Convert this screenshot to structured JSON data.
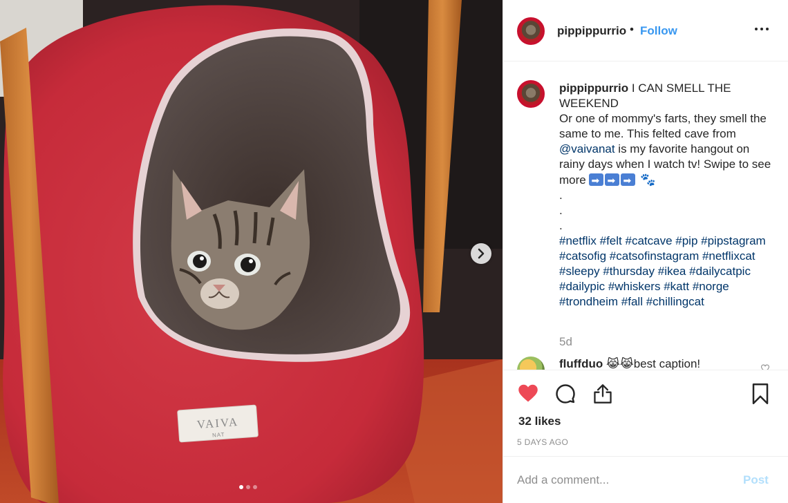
{
  "post": {
    "image_slides": 3,
    "active_slide": 1,
    "badge_text": "VAIVA",
    "badge_subtext": "NAT"
  },
  "header": {
    "username": "pippippurrio",
    "separator": "•",
    "follow_label": "Follow",
    "more_icon": "more-options-icon"
  },
  "caption": {
    "username": "pippippurrio",
    "line1": " I CAN SMELL THE WEEKEND",
    "line2": "Or one of mommy's farts, they smell the same to me. This felted cave from ",
    "mention": "@vaivanat",
    "line3": " is my favorite hangout on rainy days when I watch tv! Swipe to see more ",
    "paw": "🐾",
    "dot1": ".",
    "dot2": ".",
    "dot3": ".",
    "hashtags": [
      "#netflix",
      "#felt",
      "#catcave",
      "#pip",
      "#pipstagram",
      "#catsofig",
      "#catsofinstagram",
      "#netflixcat",
      "#sleepy",
      "#thursday",
      "#ikea",
      "#dailycatpic",
      "#dailypic",
      "#whiskers",
      "#katt",
      "#norge",
      "#trondheim",
      "#fall",
      "#chillingcat"
    ],
    "time": "5d"
  },
  "comment": {
    "username": "fluffduo",
    "emojis": "😹😹",
    "text": "best caption!"
  },
  "stats": {
    "likes": "32 likes",
    "posted": "5 DAYS AGO"
  },
  "add_comment": {
    "placeholder": "Add a comment...",
    "post_label": "Post"
  },
  "colors": {
    "accent": "#3897f0",
    "like": "#ed4956",
    "hashtag": "#003569",
    "post_disabled": "#b2dffc"
  }
}
